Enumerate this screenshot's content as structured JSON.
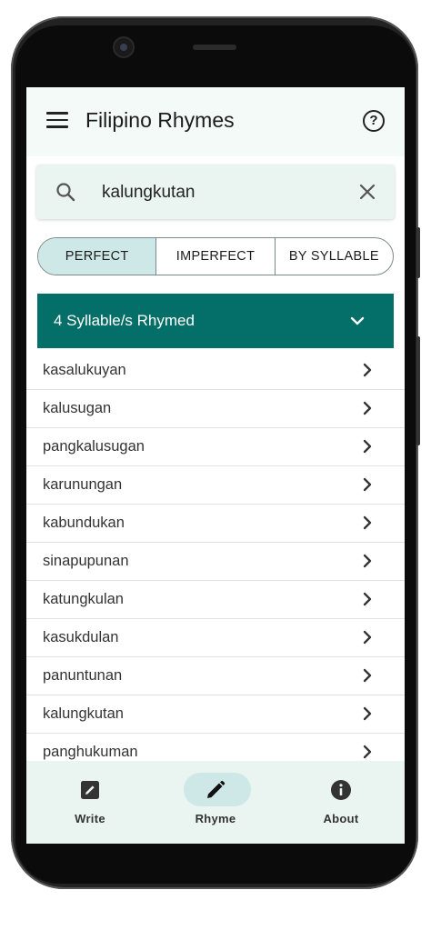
{
  "app": {
    "title": "Filipino Rhymes"
  },
  "search": {
    "value": "kalungkutan",
    "placeholder": ""
  },
  "segments": {
    "items": [
      "PERFECT",
      "IMPERFECT",
      "BY SYLLABLE"
    ],
    "selected": "PERFECT"
  },
  "accordion": {
    "title": "4 Syllable/s Rhymed",
    "expanded": true
  },
  "results": [
    "kasalukuyan",
    "kalusugan",
    "pangkalusugan",
    "karunungan",
    "kabundukan",
    "sinapupunan",
    "katungkulan",
    "kasukdulan",
    "panuntunan",
    "kalungkutan",
    "panghukuman"
  ],
  "nav": {
    "items": [
      {
        "label": "Write",
        "icon": "edit-box-icon"
      },
      {
        "label": "Rhyme",
        "icon": "pencil-icon",
        "active": true
      },
      {
        "label": "About",
        "icon": "info-icon"
      }
    ]
  },
  "colors": {
    "accent": "#046e68",
    "selected_bg": "#cde8e6",
    "surface": "#eaf5f2"
  }
}
